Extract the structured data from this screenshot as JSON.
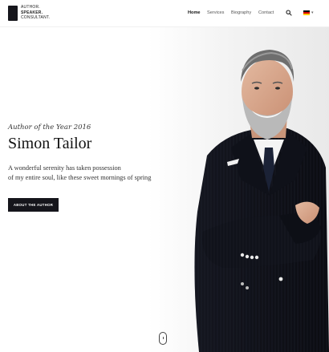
{
  "brand": {
    "line1": "AUTHOR.",
    "line2": "SPEAKER.",
    "line3": "CONSULTANT."
  },
  "nav": {
    "items": [
      {
        "label": "Home",
        "active": true
      },
      {
        "label": "Services",
        "active": false
      },
      {
        "label": "Biography",
        "active": false
      },
      {
        "label": "Contact",
        "active": false
      }
    ],
    "search_icon": "search-icon",
    "language_flag": "germany-flag-icon"
  },
  "hero": {
    "kicker": "Author of the Year 2016",
    "title": "Simon Tailor",
    "subtitle_line1": "A wonderful serenity has taken possession",
    "subtitle_line2": "of my entire soul, like these sweet mornings of spring",
    "cta_label": "ABOUT THE AUTHOR"
  },
  "colors": {
    "primary_dark": "#15151b",
    "text": "#111111",
    "background": "#ffffff"
  }
}
